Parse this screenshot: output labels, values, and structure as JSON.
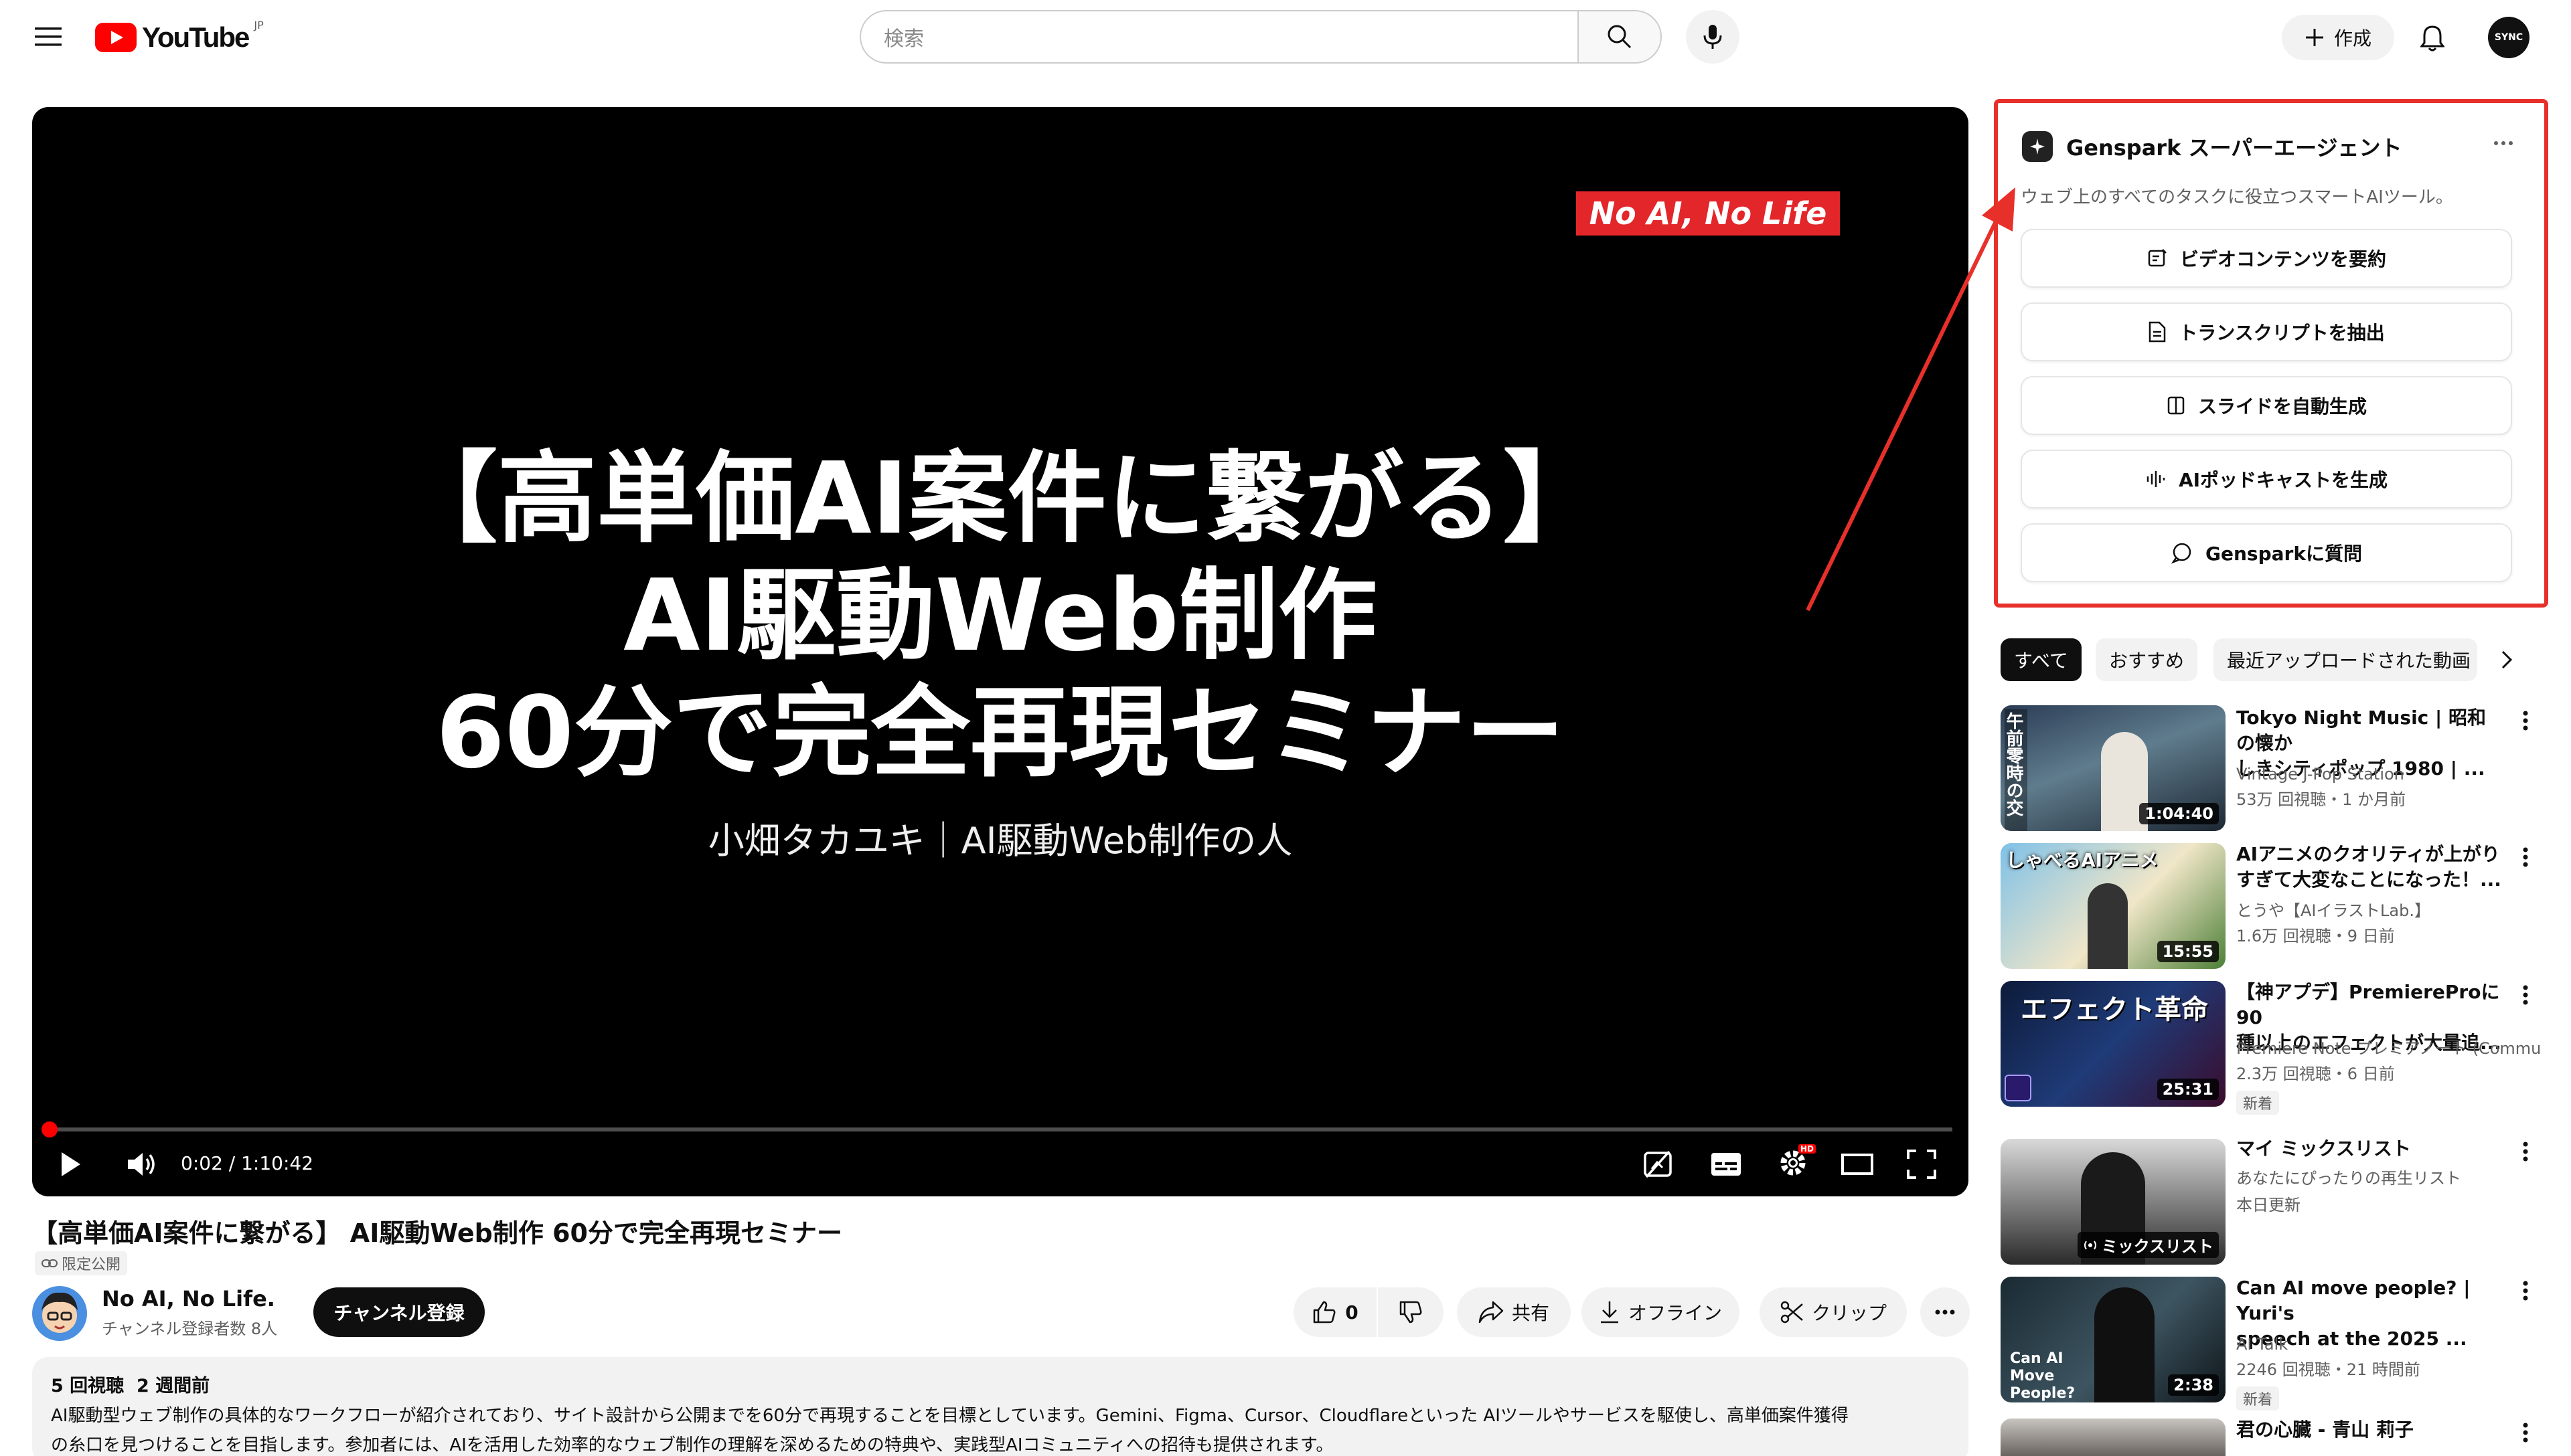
{
  "header": {
    "logo_text": "YouTube",
    "region": "JP",
    "search_placeholder": "検索",
    "create_label": "作成",
    "avatar_text": "SYNC"
  },
  "player": {
    "badge": "No AI, No Life",
    "line1": "【高単価AI案件に繋がる】",
    "line2": "AI駆動Web制作",
    "line3": "60分で完全再現セミナー",
    "subtitle": "小畑タカユキ｜AI駆動Web制作の人",
    "time": "0:02 / 1:10:42",
    "progress": 0.0005
  },
  "video": {
    "title": "【高単価AI案件に繋がる】 AI駆動Web制作 60分で完全再現セミナー",
    "visibility": "限定公開",
    "channel_name": "No AI, No Life.",
    "subscribers": "チャンネル登録者数 8人",
    "subscribe_label": "チャンネル登録",
    "like_count": "0",
    "share_label": "共有",
    "offline_label": "オフライン",
    "clip_label": "クリップ",
    "views": "5 回視聴",
    "posted": "2 週間前",
    "desc_line1": "AI駆動型ウェブ制作の具体的なワークフローが紹介されており、サイト設計から公開までを60分で再現することを目標としています。Gemini、Figma、Cursor、Cloudflareといった AIツールやサービスを駆使し、高単価案件獲得",
    "desc_line2": "の糸口を見つけることを目指します。参加者には、AIを活用した効率的なウェブ制作の理解を深めるための特典や、実践型AIコミュニティへの招待も提供されます。"
  },
  "genspark": {
    "title": "Genspark スーパーエージェント",
    "subtitle": "ウェブ上のすべてのタスクに役立つスマートAIツール。",
    "actions": [
      {
        "label": "ビデオコンテンツを要約",
        "icon": "summary-icon"
      },
      {
        "label": "トランスクリプトを抽出",
        "icon": "document-icon"
      },
      {
        "label": "スライドを自動生成",
        "icon": "slides-icon"
      },
      {
        "label": "AIポッドキャストを生成",
        "icon": "waveform-icon"
      },
      {
        "label": "Gensparkに質問",
        "icon": "chat-icon"
      }
    ],
    "accent": "#e8302b"
  },
  "chips": [
    "すべて",
    "おすすめ",
    "最近アップロードされた動画"
  ],
  "recommendations": [
    {
      "title1": "Tokyo Night Music | 昭和の懐か",
      "title2": "しきシティポップ 1980 | ...",
      "channel": "Vintage J-Pop Station",
      "meta": "53万 回視聴・1 か月前",
      "duration": "1:04:40",
      "thumb_text": "午前零時の交差点"
    },
    {
      "title1": "AIアニメのクオリティが上がり",
      "title2": "すぎて大変なことになった！...",
      "channel": "とうや【AIイラストLab.】",
      "meta": "1.6万 回視聴・9 日前",
      "duration": "15:55",
      "thumb_text": "しゃべるAIアニメ"
    },
    {
      "title1": "【神アプデ】PremiereProに90",
      "title2": "種以上のエフェクトが大量追...",
      "channel": "Premiere Note プレミアノート (Commun...",
      "meta": "2.3万 回視聴・6 日前",
      "duration": "25:31",
      "thumb_text": "エフェクト革命",
      "new": "新着"
    },
    {
      "title1": "マイ ミックスリスト",
      "title2": "",
      "channel": "あなたにぴったりの再生リスト",
      "meta": "本日更新",
      "duration": "ミックスリスト",
      "thumb_text": ""
    },
    {
      "title1": "Can AI move people? | Yuri's",
      "title2": "speech at the 2025 ...",
      "channel": "AI Talk",
      "meta": "2246 回視聴・21 時間前",
      "duration": "2:38",
      "thumb_text": "Can AI Move People?",
      "new": "新着"
    },
    {
      "title1": "君の心臓 - 青山 莉子",
      "title2": "",
      "channel": "",
      "meta": "",
      "duration": "",
      "thumb_text": ""
    }
  ]
}
